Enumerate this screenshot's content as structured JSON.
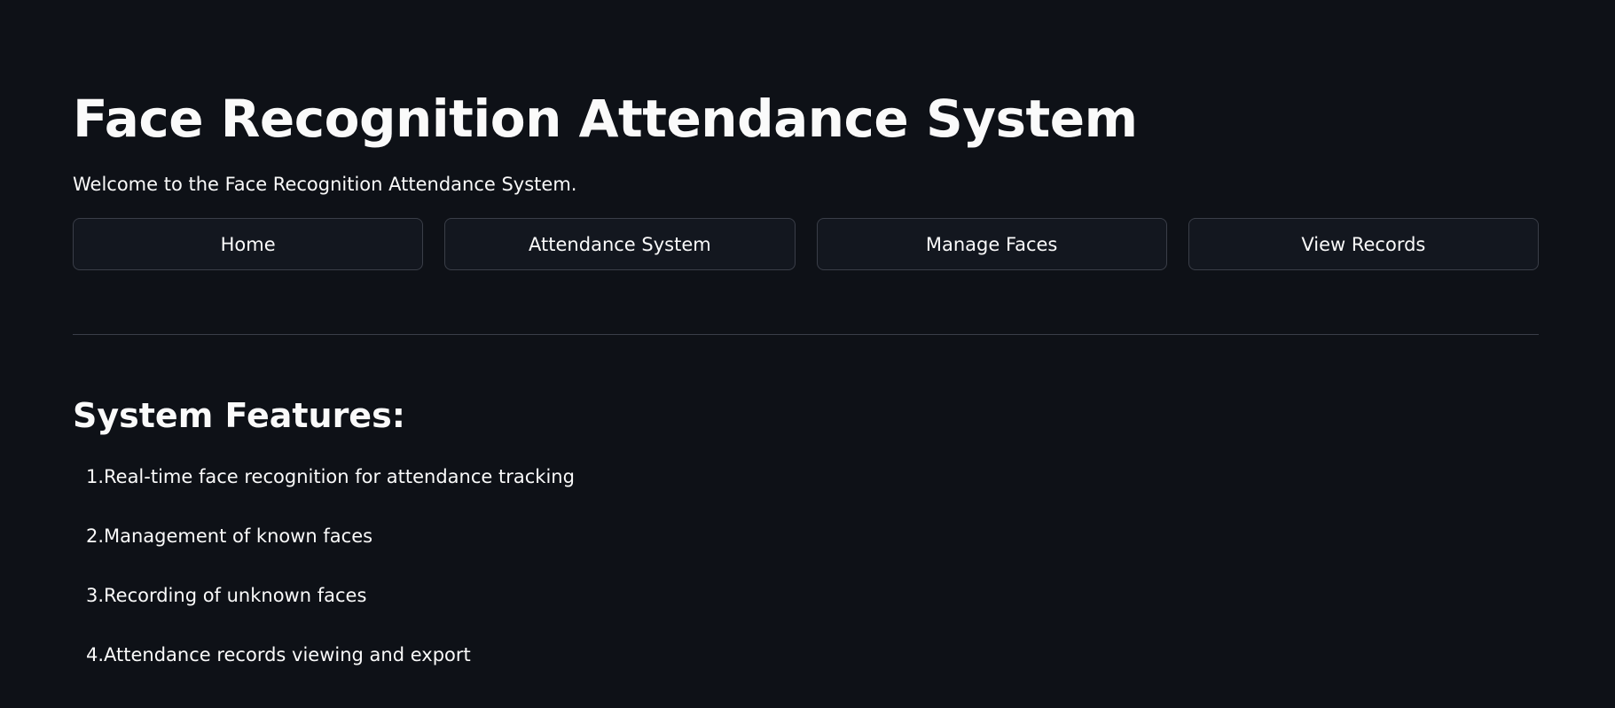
{
  "header": {
    "title": "Face Recognition Attendance System",
    "subtitle": "Welcome to the Face Recognition Attendance System."
  },
  "nav": {
    "items": [
      {
        "label": "Home"
      },
      {
        "label": "Attendance System"
      },
      {
        "label": "Manage Faces"
      },
      {
        "label": "View Records"
      }
    ]
  },
  "features": {
    "heading": "System Features:",
    "items": [
      {
        "number": "1.",
        "text": "Real-time face recognition for attendance tracking"
      },
      {
        "number": "2.",
        "text": "Management of known faces"
      },
      {
        "number": "3.",
        "text": "Recording of unknown faces"
      },
      {
        "number": "4.",
        "text": "Attendance records viewing and export"
      }
    ]
  },
  "colors": {
    "background": "#0e1117",
    "text": "#fafafa",
    "button_background": "#13171f",
    "border": "#3a3e48"
  }
}
